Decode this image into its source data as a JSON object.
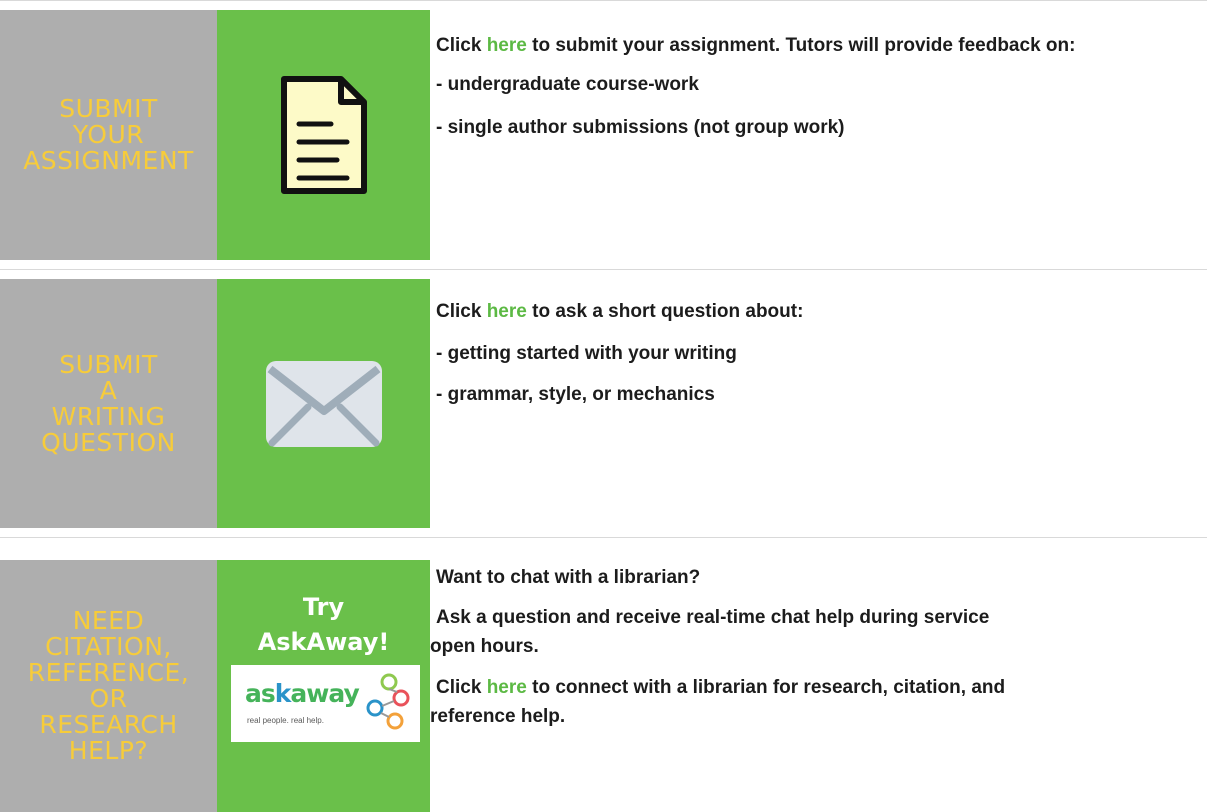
{
  "row1": {
    "label": "SUBMIT\nYOUR\nASSIGNMENT",
    "icon": "document-icon",
    "line1_before": "Click ",
    "line1_link": "here",
    "line1_after": " to submit your assignment. Tutors will provide feedback on:",
    "bullet1": "- undergraduate course-work",
    "bullet2": "- single author submissions (not group work)"
  },
  "row2": {
    "label": "SUBMIT\nA\nWRITING\nQUESTION",
    "icon": "envelope-icon",
    "line1_before": "Click ",
    "line1_link": "here",
    "line1_after": " to ask a short question about:",
    "bullet1": "- getting started with your writing",
    "bullet2": "- grammar, style, or mechanics"
  },
  "row3": {
    "label": "NEED\nCITATION,\nREFERENCE,\nOR\nRESEARCH\nHELP?",
    "try_line1": "Try",
    "try_line2": "AskAway!",
    "logo": {
      "word_start": "as",
      "word_k": "k",
      "word_end": "away",
      "tagline": "real people. real help."
    },
    "heading": "Want to chat with a librarian?",
    "para1_line1": "Ask a question and receive real-time chat help during service",
    "para1_line2": "open hours.",
    "para2_before": "Click ",
    "para2_link": "here",
    "para2_after": " to connect with a librarian for research, citation, and",
    "para2_line2": "reference help."
  },
  "colors": {
    "label_bg": "#aeaeae",
    "label_text": "#f7cc3a",
    "icon_bg": "#6ac04a",
    "link": "#5cb944"
  }
}
